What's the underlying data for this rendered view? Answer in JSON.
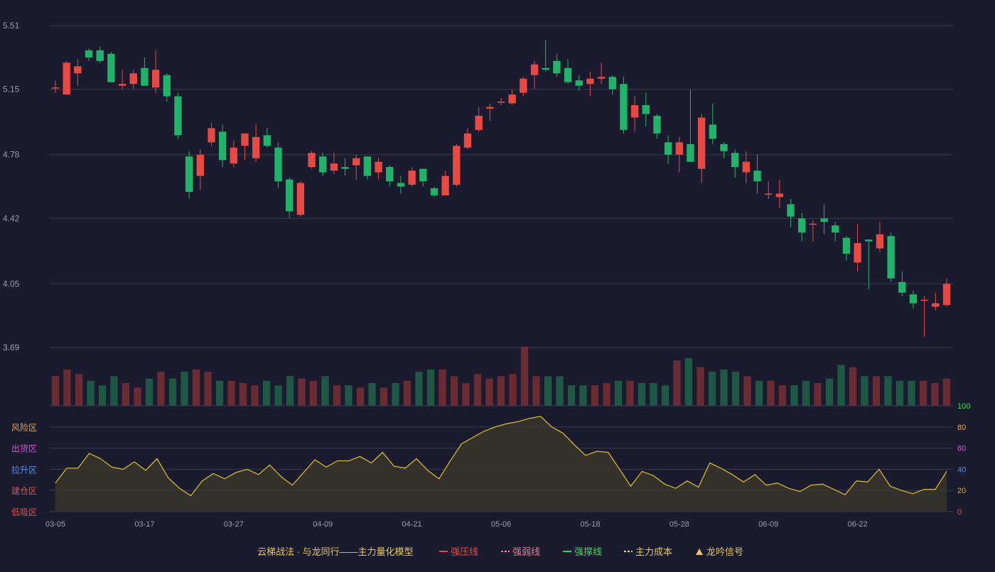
{
  "chart_data": {
    "type": "candlestick",
    "colors": {
      "background": "#1a1b2e",
      "grid": "#3a3b4e",
      "up": "#e84a43",
      "down": "#22b36a",
      "volume_up": "#6b2b33",
      "volume_down": "#1e5844",
      "cost_line": "#d4b62c",
      "cost_fill": "#3a352b",
      "axis_text": "#9a9aa8"
    },
    "price_axis": {
      "ticks": [
        "5.51",
        "5.15",
        "4.78",
        "4.42",
        "4.05",
        "3.69"
      ],
      "range": [
        3.69,
        5.51
      ]
    },
    "dates": [
      "03-05",
      "03-17",
      "03-27",
      "04-09",
      "04-21",
      "05-06",
      "05-18",
      "05-28",
      "06-09",
      "06-22"
    ],
    "candles": [
      [
        5.16,
        5.16,
        5.2,
        5.13
      ],
      [
        5.12,
        5.3,
        5.31,
        5.12
      ],
      [
        5.24,
        5.28,
        5.32,
        5.17
      ],
      [
        5.37,
        5.33,
        5.38,
        5.31
      ],
      [
        5.37,
        5.31,
        5.39,
        5.3
      ],
      [
        5.35,
        5.19,
        5.36,
        5.19
      ],
      [
        5.17,
        5.18,
        5.26,
        5.15
      ],
      [
        5.18,
        5.24,
        5.26,
        5.15
      ],
      [
        5.27,
        5.17,
        5.33,
        5.17
      ],
      [
        5.16,
        5.26,
        5.37,
        5.13
      ],
      [
        5.23,
        5.11,
        5.24,
        5.08
      ],
      [
        5.11,
        4.89,
        5.13,
        4.87
      ],
      [
        4.77,
        4.57,
        4.8,
        4.53
      ],
      [
        4.66,
        4.78,
        4.81,
        4.58
      ],
      [
        4.85,
        4.93,
        4.96,
        4.83
      ],
      [
        4.91,
        4.75,
        4.95,
        4.71
      ],
      [
        4.73,
        4.82,
        4.86,
        4.71
      ],
      [
        4.83,
        4.9,
        4.9,
        4.75
      ],
      [
        4.76,
        4.88,
        4.95,
        4.74
      ],
      [
        4.89,
        4.83,
        4.93,
        4.82
      ],
      [
        4.82,
        4.63,
        4.85,
        4.59
      ],
      [
        4.64,
        4.46,
        4.65,
        4.42
      ],
      [
        4.44,
        4.62,
        4.63,
        4.43
      ],
      [
        4.71,
        4.79,
        4.8,
        4.7
      ],
      [
        4.77,
        4.68,
        4.79,
        4.66
      ],
      [
        4.69,
        4.73,
        4.79,
        4.67
      ],
      [
        4.71,
        4.7,
        4.76,
        4.66
      ],
      [
        4.72,
        4.76,
        4.78,
        4.64
      ],
      [
        4.77,
        4.66,
        4.77,
        4.64
      ],
      [
        4.68,
        4.74,
        4.76,
        4.64
      ],
      [
        4.71,
        4.63,
        4.72,
        4.6
      ],
      [
        4.62,
        4.6,
        4.66,
        4.56
      ],
      [
        4.61,
        4.69,
        4.71,
        4.6
      ],
      [
        4.7,
        4.63,
        4.7,
        4.6
      ],
      [
        4.59,
        4.55,
        4.6,
        4.54
      ],
      [
        4.55,
        4.66,
        4.69,
        4.55
      ],
      [
        4.61,
        4.83,
        4.84,
        4.6
      ],
      [
        4.82,
        4.9,
        4.93,
        4.81
      ],
      [
        4.92,
        5.0,
        5.05,
        4.91
      ],
      [
        5.04,
        5.05,
        5.07,
        4.97
      ],
      [
        5.08,
        5.08,
        5.1,
        5.06
      ],
      [
        5.07,
        5.12,
        5.15,
        5.06
      ],
      [
        5.13,
        5.21,
        5.22,
        5.11
      ],
      [
        5.23,
        5.29,
        5.31,
        5.15
      ],
      [
        5.27,
        5.26,
        5.43,
        5.25
      ],
      [
        5.31,
        5.24,
        5.35,
        5.22
      ],
      [
        5.27,
        5.19,
        5.32,
        5.18
      ],
      [
        5.2,
        5.17,
        5.23,
        5.14
      ],
      [
        5.18,
        5.21,
        5.25,
        5.11
      ],
      [
        5.21,
        5.22,
        5.3,
        5.18
      ],
      [
        5.22,
        5.15,
        5.23,
        5.12
      ],
      [
        5.18,
        4.92,
        5.22,
        4.9
      ],
      [
        4.99,
        5.06,
        5.11,
        4.91
      ],
      [
        5.06,
        5.01,
        5.13,
        4.94
      ],
      [
        5.0,
        4.9,
        5.01,
        4.87
      ],
      [
        4.85,
        4.78,
        4.89,
        4.73
      ],
      [
        4.78,
        4.85,
        4.88,
        4.68
      ],
      [
        4.84,
        4.74,
        5.15,
        4.74
      ],
      [
        4.7,
        4.99,
        5.01,
        4.62
      ],
      [
        4.95,
        4.87,
        5.07,
        4.84
      ],
      [
        4.84,
        4.8,
        4.85,
        4.76
      ],
      [
        4.79,
        4.71,
        4.81,
        4.65
      ],
      [
        4.68,
        4.74,
        4.8,
        4.62
      ],
      [
        4.69,
        4.63,
        4.78,
        4.56
      ],
      [
        4.56,
        4.56,
        4.63,
        4.53
      ],
      [
        4.54,
        4.56,
        4.64,
        4.48
      ],
      [
        4.5,
        4.43,
        4.53,
        4.37
      ],
      [
        4.42,
        4.34,
        4.45,
        4.29
      ],
      [
        4.39,
        4.39,
        4.41,
        4.29
      ],
      [
        4.42,
        4.4,
        4.5,
        4.33
      ],
      [
        4.38,
        4.34,
        4.4,
        4.29
      ],
      [
        4.31,
        4.22,
        4.32,
        4.18
      ],
      [
        4.17,
        4.28,
        4.39,
        4.12
      ],
      [
        4.3,
        4.29,
        4.3,
        4.02
      ],
      [
        4.25,
        4.33,
        4.4,
        4.23
      ],
      [
        4.32,
        4.08,
        4.34,
        4.06
      ],
      [
        4.06,
        4.0,
        4.12,
        3.98
      ],
      [
        3.99,
        3.94,
        4.01,
        3.91
      ],
      [
        3.96,
        3.96,
        3.98,
        3.75
      ],
      [
        3.92,
        3.94,
        4.0,
        3.9
      ],
      [
        3.93,
        4.05,
        4.08,
        3.92
      ]
    ],
    "volume": [
      13,
      16,
      14,
      11,
      9,
      13,
      10,
      8,
      12,
      15,
      12,
      15,
      16,
      15,
      11,
      11,
      10,
      9,
      11,
      9,
      13,
      12,
      11,
      13,
      9,
      9,
      8,
      10,
      8,
      10,
      11,
      15,
      16,
      16,
      13,
      10,
      14,
      12,
      13,
      14,
      26,
      13,
      13,
      13,
      9,
      9,
      9,
      10,
      11,
      11,
      10,
      10,
      9,
      20,
      21,
      17,
      15,
      16,
      15,
      13,
      11,
      11,
      9,
      9,
      11,
      10,
      12,
      18,
      17,
      13,
      13,
      13,
      11,
      11,
      11,
      10,
      12
    ],
    "main_cost": [
      27,
      41,
      41,
      55,
      50,
      42,
      40,
      47,
      39,
      50,
      32,
      22,
      15,
      29,
      36,
      31,
      37,
      40,
      35,
      44,
      33,
      25,
      37,
      49,
      42,
      48,
      48,
      52,
      46,
      56,
      43,
      41,
      50,
      39,
      31,
      48,
      64,
      70,
      76,
      80,
      83,
      85,
      88,
      90,
      80,
      74,
      63,
      53,
      57,
      56,
      40,
      24,
      38,
      34,
      26,
      22,
      29,
      23,
      46,
      41,
      35,
      28,
      35,
      25,
      27,
      22,
      19,
      25,
      26,
      21,
      16,
      29,
      28,
      40,
      24,
      20,
      17,
      21,
      21,
      38
    ],
    "indicator_axis": {
      "left_labels": [
        "风险区",
        "出货区",
        "拉升区",
        "建仓区",
        "低吸区"
      ],
      "left_colors": [
        "#e8a33a",
        "#d64fd2",
        "#4f8fe8",
        "#e84a43",
        "#e84a43"
      ],
      "right_ticks": [
        "100",
        "80",
        "60",
        "40",
        "20",
        "0"
      ],
      "right_colors": [
        "#3cd35a",
        "#e8a33a",
        "#d64fd2",
        "#4f8fe8",
        "#e8a33a",
        "#e84a43"
      ]
    },
    "legend": {
      "title": "云梯战法 · 与龙同行——主力量化模型",
      "title_color": "#e8c65a",
      "items": [
        {
          "label": "强压线",
          "color": "#e84a43",
          "style": "solid"
        },
        {
          "label": "强弱线",
          "color": "#f07a8a",
          "style": "dashed"
        },
        {
          "label": "强撑线",
          "color": "#3cd35a",
          "style": "solid"
        },
        {
          "label": "主力成本",
          "color": "#e8c65a",
          "style": "dashed"
        },
        {
          "label": "龙吟信号",
          "color": "#e8c65a",
          "style": "triangle"
        }
      ]
    }
  }
}
